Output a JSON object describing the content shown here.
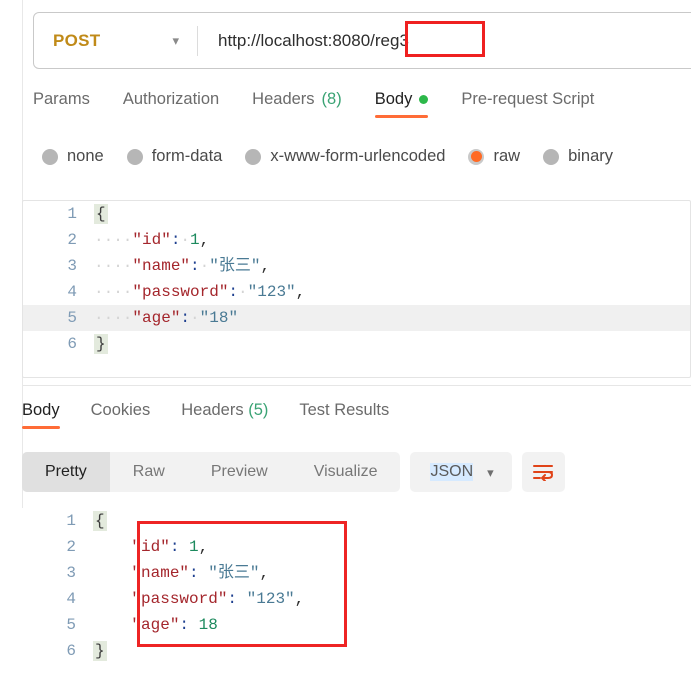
{
  "request_bar": {
    "method": "POST",
    "method_chevron": "chevron-down-icon",
    "url": "http://localhost:8080/reg3",
    "url_annotation_text": "/reg3"
  },
  "request_tabs": [
    {
      "label": "Params",
      "count": "",
      "active": false,
      "dot": false
    },
    {
      "label": "Authorization",
      "count": "",
      "active": false,
      "dot": false
    },
    {
      "label": "Headers",
      "count": "(8)",
      "active": false,
      "dot": false
    },
    {
      "label": "Body",
      "count": "",
      "active": true,
      "dot": true
    },
    {
      "label": "Pre-request Script",
      "count": "",
      "active": false,
      "dot": false
    }
  ],
  "body_type_options": [
    {
      "label": "none",
      "selected": false
    },
    {
      "label": "form-data",
      "selected": false
    },
    {
      "label": "x-www-form-urlencoded",
      "selected": false
    },
    {
      "label": "raw",
      "selected": true
    },
    {
      "label": "binary",
      "selected": false
    }
  ],
  "request_body": {
    "language": "json",
    "lines": [
      {
        "no": "1",
        "highlight": false,
        "tokens": [
          {
            "t": "brace",
            "v": "{"
          }
        ]
      },
      {
        "no": "2",
        "highlight": false,
        "tokens": [
          {
            "t": "ws",
            "v": "····"
          },
          {
            "t": "key",
            "v": "\"id\""
          },
          {
            "t": "colon",
            "v": ":"
          },
          {
            "t": "ws",
            "v": "·"
          },
          {
            "t": "num",
            "v": "1"
          },
          {
            "t": "punc",
            "v": ","
          }
        ]
      },
      {
        "no": "3",
        "highlight": false,
        "tokens": [
          {
            "t": "ws",
            "v": "····"
          },
          {
            "t": "key",
            "v": "\"name\""
          },
          {
            "t": "colon",
            "v": ":"
          },
          {
            "t": "ws",
            "v": "·"
          },
          {
            "t": "str",
            "v": "\"张三\""
          },
          {
            "t": "punc",
            "v": ","
          }
        ]
      },
      {
        "no": "4",
        "highlight": false,
        "tokens": [
          {
            "t": "ws",
            "v": "····"
          },
          {
            "t": "key",
            "v": "\"password\""
          },
          {
            "t": "colon",
            "v": ":"
          },
          {
            "t": "ws",
            "v": "·"
          },
          {
            "t": "str",
            "v": "\"123\""
          },
          {
            "t": "punc",
            "v": ","
          }
        ]
      },
      {
        "no": "5",
        "highlight": true,
        "tokens": [
          {
            "t": "ws",
            "v": "····"
          },
          {
            "t": "key",
            "v": "\"age\""
          },
          {
            "t": "colon",
            "v": ":"
          },
          {
            "t": "ws",
            "v": "·"
          },
          {
            "t": "str",
            "v": "\"18\""
          }
        ]
      },
      {
        "no": "6",
        "highlight": false,
        "tokens": [
          {
            "t": "brace",
            "v": "}"
          }
        ]
      }
    ]
  },
  "response_tabs": [
    {
      "label": "Body",
      "count": "",
      "active": true
    },
    {
      "label": "Cookies",
      "count": "",
      "active": false
    },
    {
      "label": "Headers",
      "count": "(5)",
      "active": false
    },
    {
      "label": "Test Results",
      "count": "",
      "active": false
    }
  ],
  "view_toolbar": {
    "modes": [
      {
        "label": "Pretty",
        "active": true
      },
      {
        "label": "Raw",
        "active": false
      },
      {
        "label": "Preview",
        "active": false
      },
      {
        "label": "Visualize",
        "active": false
      }
    ],
    "format": "JSON",
    "format_chevron": "chevron-down-icon",
    "wrap_icon": "wrap-lines-icon"
  },
  "response_body": {
    "language": "json",
    "lines": [
      {
        "no": "1",
        "highlight": false,
        "tokens": [
          {
            "t": "brace",
            "v": "{"
          }
        ]
      },
      {
        "no": "2",
        "highlight": false,
        "tokens": [
          {
            "t": "plain",
            "v": "    "
          },
          {
            "t": "key",
            "v": "\"id\""
          },
          {
            "t": "colon",
            "v": ":"
          },
          {
            "t": "plain",
            "v": " "
          },
          {
            "t": "num",
            "v": "1"
          },
          {
            "t": "punc",
            "v": ","
          }
        ]
      },
      {
        "no": "3",
        "highlight": false,
        "tokens": [
          {
            "t": "plain",
            "v": "    "
          },
          {
            "t": "key",
            "v": "\"name\""
          },
          {
            "t": "colon",
            "v": ":"
          },
          {
            "t": "plain",
            "v": " "
          },
          {
            "t": "str",
            "v": "\"张三\""
          },
          {
            "t": "punc",
            "v": ","
          }
        ]
      },
      {
        "no": "4",
        "highlight": false,
        "tokens": [
          {
            "t": "plain",
            "v": "    "
          },
          {
            "t": "key",
            "v": "\"password\""
          },
          {
            "t": "colon",
            "v": ":"
          },
          {
            "t": "plain",
            "v": " "
          },
          {
            "t": "str",
            "v": "\"123\""
          },
          {
            "t": "punc",
            "v": ","
          }
        ]
      },
      {
        "no": "5",
        "highlight": false,
        "tokens": [
          {
            "t": "plain",
            "v": "    "
          },
          {
            "t": "key",
            "v": "\"age\""
          },
          {
            "t": "colon",
            "v": ":"
          },
          {
            "t": "plain",
            "v": " "
          },
          {
            "t": "num",
            "v": "18"
          }
        ]
      },
      {
        "no": "6",
        "highlight": false,
        "tokens": [
          {
            "t": "brace",
            "v": "}"
          }
        ]
      }
    ]
  },
  "colors": {
    "accent": "#ff6c37",
    "method": "#c08a18",
    "annotation": "#ee2424",
    "json_key": "#a4262c",
    "json_string": "#4a7a94",
    "json_number": "#1d8a5e",
    "dot_green": "#2db84a"
  }
}
